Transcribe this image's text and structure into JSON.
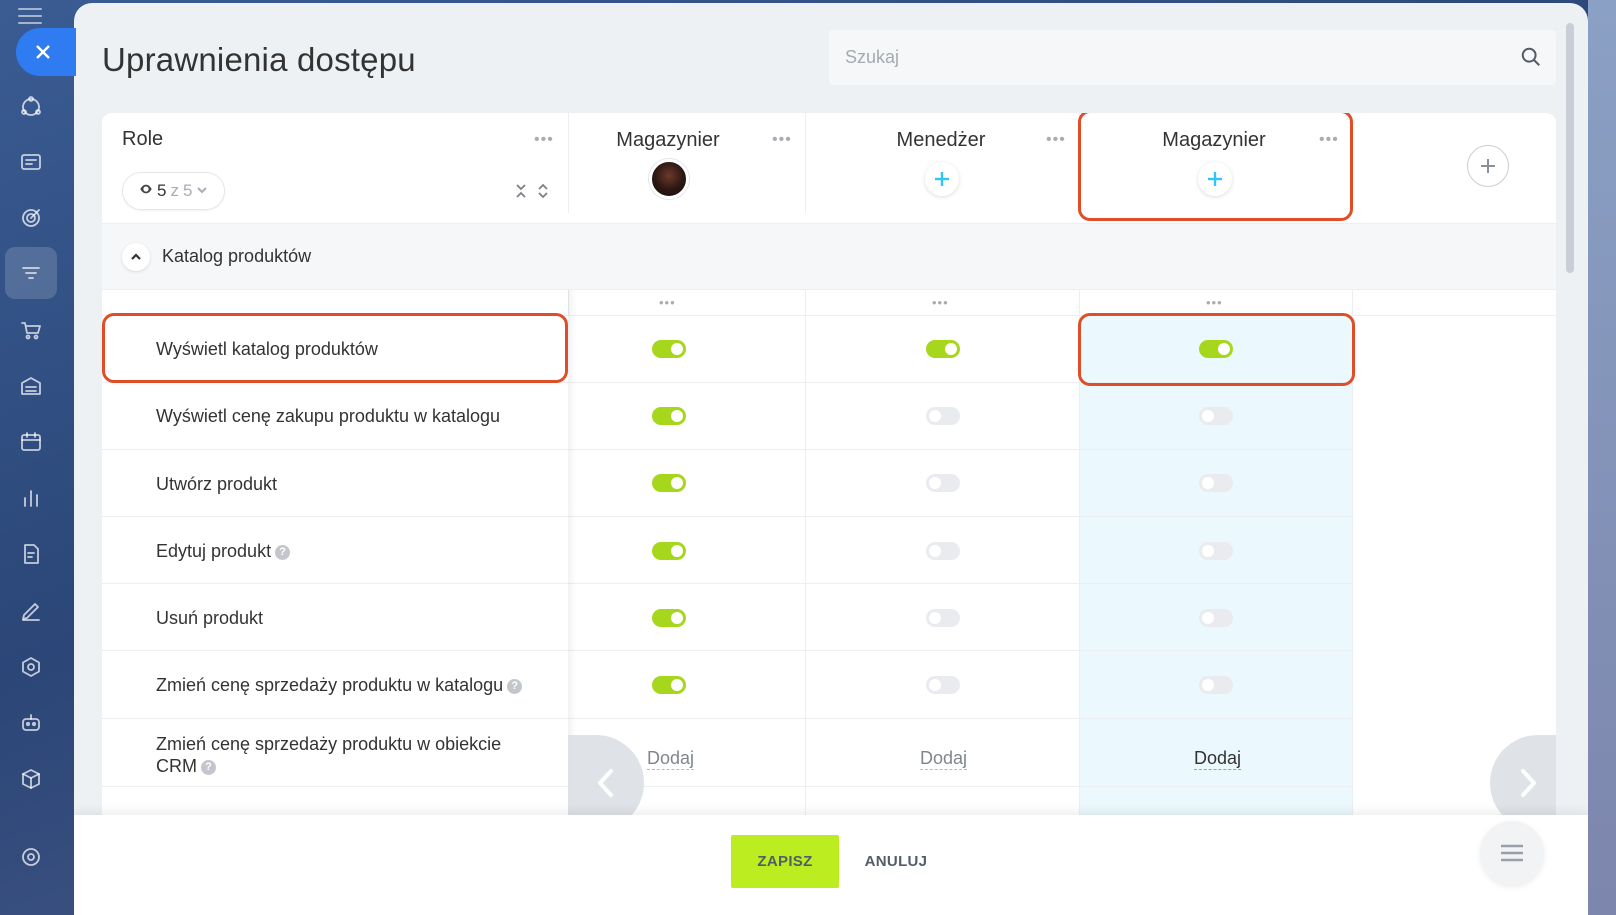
{
  "page": {
    "title": "Uprawnienia dostępu"
  },
  "search": {
    "placeholder": "Szukaj"
  },
  "roles_header": {
    "title": "Role",
    "counter_value": "5",
    "counter_separator": "z",
    "counter_total": "5"
  },
  "columns": [
    {
      "title": "Magazynier",
      "assignee": "avatar"
    },
    {
      "title": "Menedżer",
      "assignee": "add"
    },
    {
      "title": "Magazynier",
      "assignee": "add",
      "highlighted": true
    }
  ],
  "section": {
    "title": "Katalog produktów"
  },
  "permissions": [
    {
      "label": "Wyświetl katalog produktów",
      "help": false,
      "values": [
        "on",
        "on",
        "on"
      ]
    },
    {
      "label": "Wyświetl cenę zakupu produktu w katalogu",
      "help": false,
      "values": [
        "on",
        "off",
        "off"
      ]
    },
    {
      "label": "Utwórz produkt",
      "help": false,
      "values": [
        "on",
        "off",
        "off"
      ]
    },
    {
      "label": "Edytuj produkt",
      "help": true,
      "values": [
        "on",
        "off",
        "off"
      ]
    },
    {
      "label": "Usuń produkt",
      "help": false,
      "values": [
        "on",
        "off",
        "off"
      ]
    },
    {
      "label": "Zmień cenę sprzedaży produktu w katalogu",
      "help": true,
      "values": [
        "on",
        "off",
        "off"
      ]
    },
    {
      "label_line1": "Zmień cenę sprzedaży produktu w obiekcie",
      "label_line2": "CRM",
      "help": true,
      "values": [
        "Dodaj",
        "Dodaj",
        "Dodaj"
      ]
    }
  ],
  "footer": {
    "save_label": "ZAPISZ",
    "cancel_label": "ANULUJ"
  },
  "colors": {
    "accent_green": "#bbed21",
    "toggle_on": "#a6d71d",
    "callout": "#e04e27",
    "plus_blue": "#2fc6f6",
    "close_blue": "#2f7bf2"
  }
}
